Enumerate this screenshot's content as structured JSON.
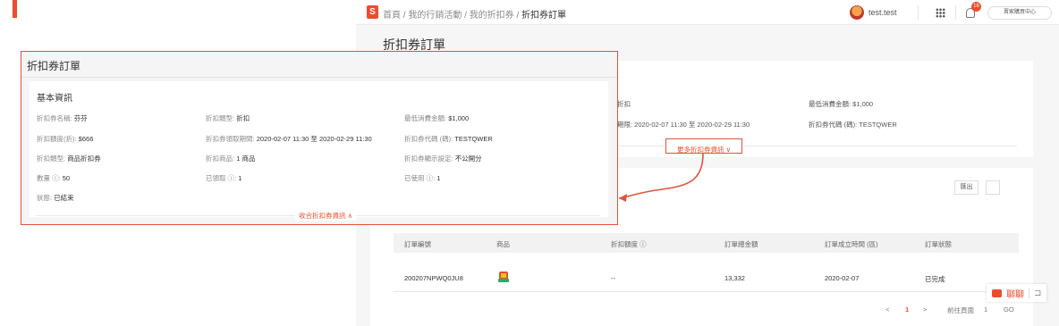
{
  "topbar": {
    "logo_letter": "S",
    "breadcrumbs": [
      "首頁",
      "我的行銷活動",
      "我的折扣券"
    ],
    "breadcrumb_sep": "/",
    "breadcrumb_current": "折扣券訂單",
    "username": "test.test",
    "notification_count": "16",
    "seller_center_label": "賣家購買中心"
  },
  "background": {
    "page_title": "折扣券訂單",
    "info_fields": [
      {
        "text": "折扣"
      },
      {
        "text": "最低消費金額: $1,000"
      },
      {
        "text": "期限: 2020-02-07 11:30 至 2020-02-29 11:30"
      },
      {
        "text": "折扣券代碼 (碼): TESTQWER"
      }
    ],
    "more_link": "更多折扣券資訊 ∨",
    "export_button": "匯出",
    "table": {
      "headers": [
        "訂單編號",
        "商品",
        "折扣額度 ⓘ",
        "訂單總金額",
        "訂單成立時間 (區)",
        "訂單狀態"
      ],
      "rows": [
        {
          "order_id": "200207NPWQ0JU8",
          "product": "",
          "discount": "--",
          "total": "13,332",
          "created": "2020-02-07",
          "status": "已完成"
        }
      ]
    },
    "pagination": {
      "prev": "<",
      "current_page": "1",
      "next": ">",
      "goto_label": "前往頁面",
      "goto_value": "1",
      "go": "GO"
    },
    "chat": {
      "label": "聊聊"
    }
  },
  "popup": {
    "title": "折扣券訂單",
    "section_title": "基本資訊",
    "fields": [
      {
        "label": "折扣券名稱:",
        "value": "芬芬"
      },
      {
        "label": "折扣類型:",
        "value": "折扣"
      },
      {
        "label": "最低消費金額:",
        "value": "$1,000"
      },
      {
        "label": "折扣額度(折):",
        "value": "$666"
      },
      {
        "label": "折扣券領取期間:",
        "value": "2020-02-07 11:30 至 2020-02-29 11:30"
      },
      {
        "label": "折扣券代碼 (碼):",
        "value": "TESTQWER"
      },
      {
        "label": "折扣類型:",
        "value": "商品折扣券"
      },
      {
        "label": "折扣商品:",
        "value": "1 商品"
      },
      {
        "label": "折扣券顯示設定:",
        "value": "不公開分"
      },
      {
        "label": "數量 ⓘ:",
        "value": "50"
      },
      {
        "label": "已領取 ⓘ:",
        "value": "1"
      },
      {
        "label": "已使用 ⓘ:",
        "value": "1"
      },
      {
        "label": "狀態:",
        "value": "已結束"
      }
    ],
    "collapse_link": "收合折扣券資訊 ∧"
  },
  "colors": {
    "accent": "#ee4d2d",
    "highlight_border": "#e2533a",
    "background": "#f6f6f6",
    "table_header": "#f2f2f2"
  },
  "icons": [
    "shopee-logo-icon",
    "user-avatar-icon",
    "apps-grid-icon",
    "notification-bell-icon",
    "info-icon",
    "chevron-down-icon",
    "chevron-up-icon",
    "list-view-icon",
    "chat-icon",
    "minimize-chat-icon",
    "connector-arrow-icon"
  ]
}
